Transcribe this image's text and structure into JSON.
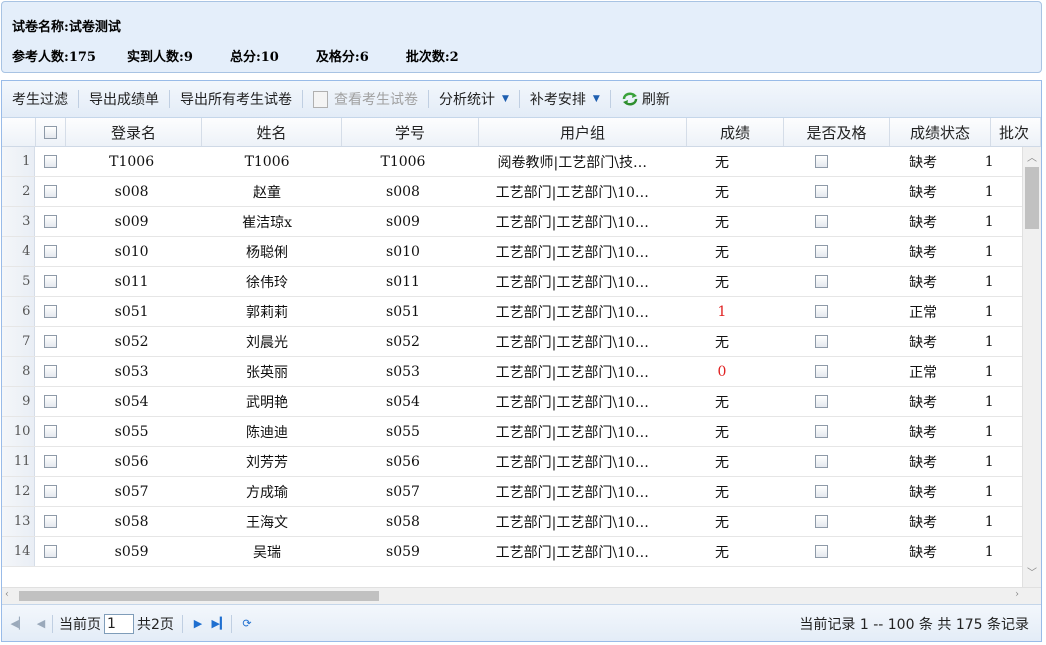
{
  "info": {
    "exam_name_label": "试卷名称:",
    "exam_name": "试卷测试",
    "participants_label": "参考人数:",
    "participants": "175",
    "attended_label": "实到人数:",
    "attended": "9",
    "total_label": "总分:",
    "total": "10",
    "pass_label": "及格分:",
    "pass": "6",
    "batch_label": "批次数:",
    "batch": "2"
  },
  "toolbar": {
    "filter": "考生过滤",
    "export_scores": "导出成绩单",
    "export_all": "导出所有考生试卷",
    "view_paper": "查看考生试卷",
    "analysis": "分析统计",
    "makeup": "补考安排",
    "refresh": "刷新"
  },
  "columns": [
    "登录名",
    "姓名",
    "学号",
    "用户组",
    "成绩",
    "是否及格",
    "成绩状态",
    "批次"
  ],
  "rows": [
    {
      "num": "1",
      "login": "T1006",
      "name": "T1006",
      "id": "T1006",
      "group": "阅卷教师|工艺部门\\技…",
      "score": "无",
      "status": "缺考",
      "batch": "1"
    },
    {
      "num": "2",
      "login": "s008",
      "name": "赵童",
      "id": "s008",
      "group": "工艺部门|工艺部门\\10…",
      "score": "无",
      "status": "缺考",
      "batch": "1"
    },
    {
      "num": "3",
      "login": "s009",
      "name": "崔洁琼x",
      "id": "s009",
      "group": "工艺部门|工艺部门\\10…",
      "score": "无",
      "status": "缺考",
      "batch": "1"
    },
    {
      "num": "4",
      "login": "s010",
      "name": "杨聪俐",
      "id": "s010",
      "group": "工艺部门|工艺部门\\10…",
      "score": "无",
      "status": "缺考",
      "batch": "1"
    },
    {
      "num": "5",
      "login": "s011",
      "name": "徐伟玲",
      "id": "s011",
      "group": "工艺部门|工艺部门\\10…",
      "score": "无",
      "status": "缺考",
      "batch": "1"
    },
    {
      "num": "6",
      "login": "s051",
      "name": "郭莉莉",
      "id": "s051",
      "group": "工艺部门|工艺部门\\10…",
      "score": "1",
      "status": "正常",
      "batch": "1"
    },
    {
      "num": "7",
      "login": "s052",
      "name": "刘晨光",
      "id": "s052",
      "group": "工艺部门|工艺部门\\10…",
      "score": "无",
      "status": "缺考",
      "batch": "1"
    },
    {
      "num": "8",
      "login": "s053",
      "name": "张英丽",
      "id": "s053",
      "group": "工艺部门|工艺部门\\10…",
      "score": "0",
      "status": "正常",
      "batch": "1"
    },
    {
      "num": "9",
      "login": "s054",
      "name": "武明艳",
      "id": "s054",
      "group": "工艺部门|工艺部门\\10…",
      "score": "无",
      "status": "缺考",
      "batch": "1"
    },
    {
      "num": "10",
      "login": "s055",
      "name": "陈迪迪",
      "id": "s055",
      "group": "工艺部门|工艺部门\\10…",
      "score": "无",
      "status": "缺考",
      "batch": "1"
    },
    {
      "num": "11",
      "login": "s056",
      "name": "刘芳芳",
      "id": "s056",
      "group": "工艺部门|工艺部门\\10…",
      "score": "无",
      "status": "缺考",
      "batch": "1"
    },
    {
      "num": "12",
      "login": "s057",
      "name": "方成瑜",
      "id": "s057",
      "group": "工艺部门|工艺部门\\10…",
      "score": "无",
      "status": "缺考",
      "batch": "1"
    },
    {
      "num": "13",
      "login": "s058",
      "name": "王海文",
      "id": "s058",
      "group": "工艺部门|工艺部门\\10…",
      "score": "无",
      "status": "缺考",
      "batch": "1"
    },
    {
      "num": "14",
      "login": "s059",
      "name": "吴瑞",
      "id": "s059",
      "group": "工艺部门|工艺部门\\10…",
      "score": "无",
      "status": "缺考",
      "batch": "1"
    }
  ],
  "pager": {
    "current_label": "当前页",
    "current_page": "1",
    "total_pages": "共2页",
    "record_info": "当前记录 1 -- 100 条 共 175 条记录"
  },
  "colors": {
    "accent": "#1f6fd0",
    "score_highlight": "#e02020",
    "header_bg": "#e4eefa"
  }
}
